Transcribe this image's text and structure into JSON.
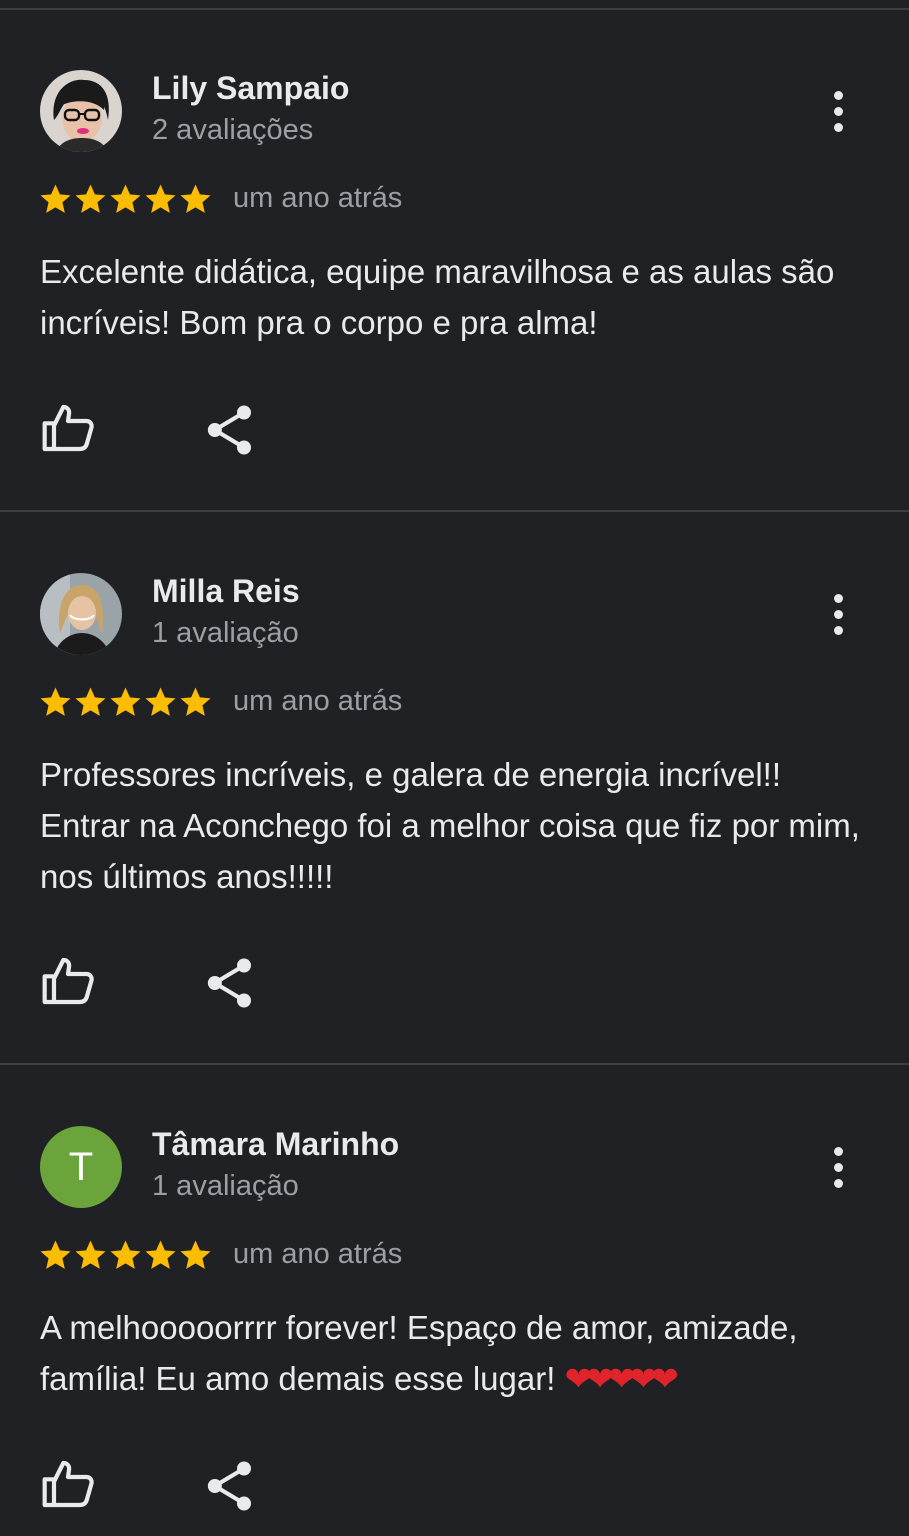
{
  "colors": {
    "background": "#202124",
    "divider": "#3c4043",
    "star": "#fbbc04",
    "heart": "#e0242b",
    "avatar_letter_bg": "#6aa43a"
  },
  "reviews": [
    {
      "name": "Lily Sampaio",
      "review_count": "2 avaliações",
      "rating": 5,
      "date": "um ano atrás",
      "text": "Excelente didática, equipe maravilhosa e as aulas são incríveis! Bom pra o corpo e pra alma!",
      "emoji": ""
    },
    {
      "name": "Milla Reis",
      "review_count": "1 avaliação",
      "rating": 5,
      "date": "um ano atrás",
      "text": "Professores incríveis, e galera de energia incrível!! Entrar na Aconchego foi a melhor coisa que fiz por mim, nos últimos anos!!!!!",
      "emoji": ""
    },
    {
      "name": "Tâmara Marinho",
      "avatar_letter": "T",
      "review_count": "1 avaliação",
      "rating": 5,
      "date": "um ano atrás",
      "text": "A melhooooorrrr forever! Espaço de amor, amizade, família! Eu amo demais esse lugar!",
      "emoji": "❤❤❤❤❤"
    }
  ],
  "icons": {
    "like": "thumbs-up-icon",
    "share": "share-icon",
    "more": "more-vert-icon",
    "star": "star-icon"
  }
}
